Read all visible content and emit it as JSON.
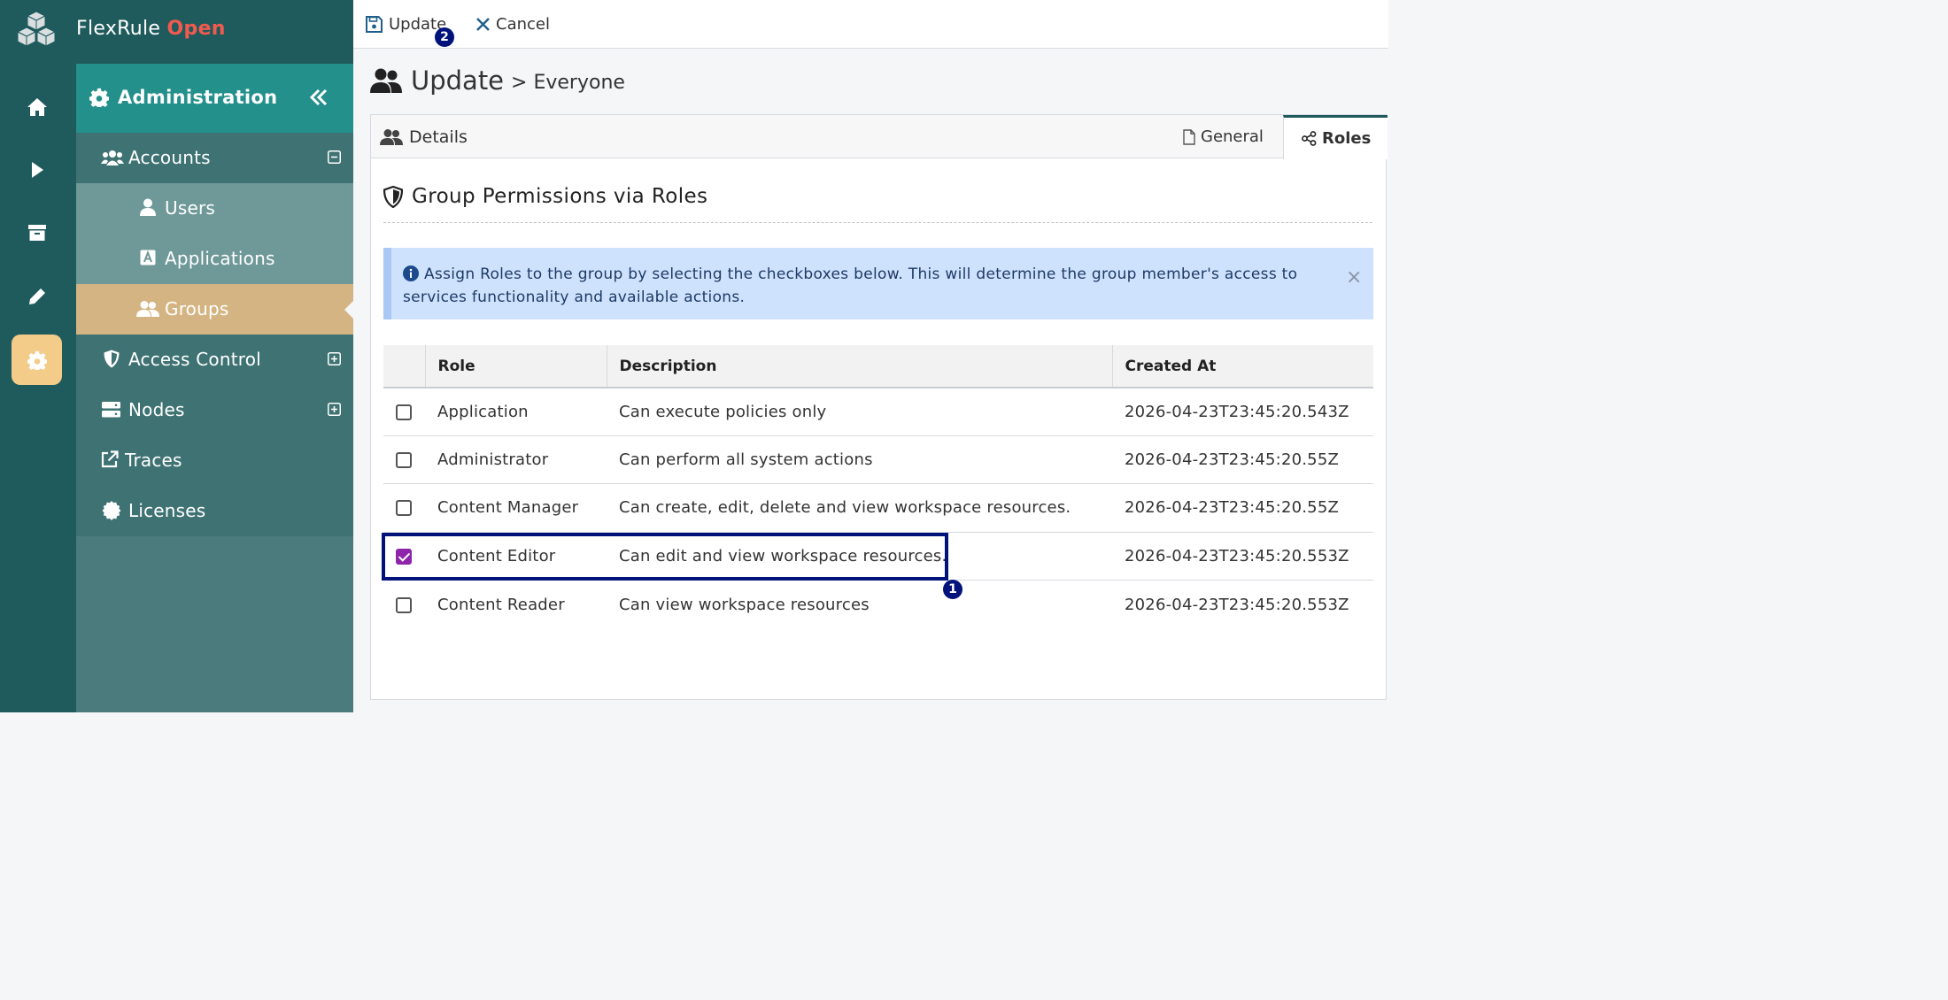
{
  "brand": {
    "name": "FlexRule",
    "accent": "Open"
  },
  "rail": {
    "items": [
      {
        "icon": "home-icon"
      },
      {
        "icon": "play-icon"
      },
      {
        "icon": "archive-icon"
      },
      {
        "icon": "pencil-icon"
      },
      {
        "icon": "gear-icon",
        "active": true
      }
    ]
  },
  "sidebar": {
    "title": "Administration",
    "items": [
      {
        "label": "Accounts",
        "icon": "users-icon",
        "expander": "minus"
      },
      {
        "label": "Users",
        "icon": "user-icon"
      },
      {
        "label": "Applications",
        "icon": "app-icon"
      },
      {
        "label": "Groups",
        "icon": "group-icon",
        "active": true
      },
      {
        "label": "Access Control",
        "icon": "shield-icon",
        "expander": "plus"
      },
      {
        "label": "Nodes",
        "icon": "server-icon",
        "expander": "plus"
      },
      {
        "label": "Traces",
        "icon": "external-link-icon"
      },
      {
        "label": "Licenses",
        "icon": "certificate-icon"
      }
    ]
  },
  "toolbar": {
    "update_label": "Update",
    "cancel_label": "Cancel",
    "update_badge": "2"
  },
  "page": {
    "title": "Update",
    "subtitle": "> Everyone"
  },
  "card": {
    "header_label": "Details",
    "tabs": [
      {
        "label": "General"
      },
      {
        "label": "Roles",
        "active": true
      }
    ]
  },
  "section": {
    "title": "Group Permissions via Roles"
  },
  "alert": {
    "text": "Assign Roles to the group by selecting the checkboxes below. This will determine the group member's access to services functionality and available actions.",
    "close": "×"
  },
  "table": {
    "columns": [
      "Role",
      "Description",
      "Created At"
    ],
    "rows": [
      {
        "checked": false,
        "role": "Application",
        "description": "Can execute policies only",
        "created": "2026-04-23T23:45:20.543Z"
      },
      {
        "checked": false,
        "role": "Administrator",
        "description": "Can perform all system actions",
        "created": "2026-04-23T23:45:20.55Z"
      },
      {
        "checked": false,
        "role": "Content Manager",
        "description": "Can create, edit, delete and view workspace resources.",
        "created": "2026-04-23T23:45:20.55Z"
      },
      {
        "checked": true,
        "role": "Content Editor",
        "description": "Can edit and view workspace resources.",
        "created": "2026-04-23T23:45:20.553Z"
      },
      {
        "checked": false,
        "role": "Content Reader",
        "description": "Can view workspace resources",
        "created": "2026-04-23T23:45:20.553Z"
      }
    ]
  },
  "annotation": {
    "highlight_badge": "1"
  },
  "colors": {
    "brand_dark": "#1f5a5c",
    "teal_header": "#23908c",
    "active_nav": "#d5b483",
    "accent_red": "#f15a4f",
    "checkbox_checked": "#8e24aa",
    "annotation_blue": "#00137a"
  }
}
